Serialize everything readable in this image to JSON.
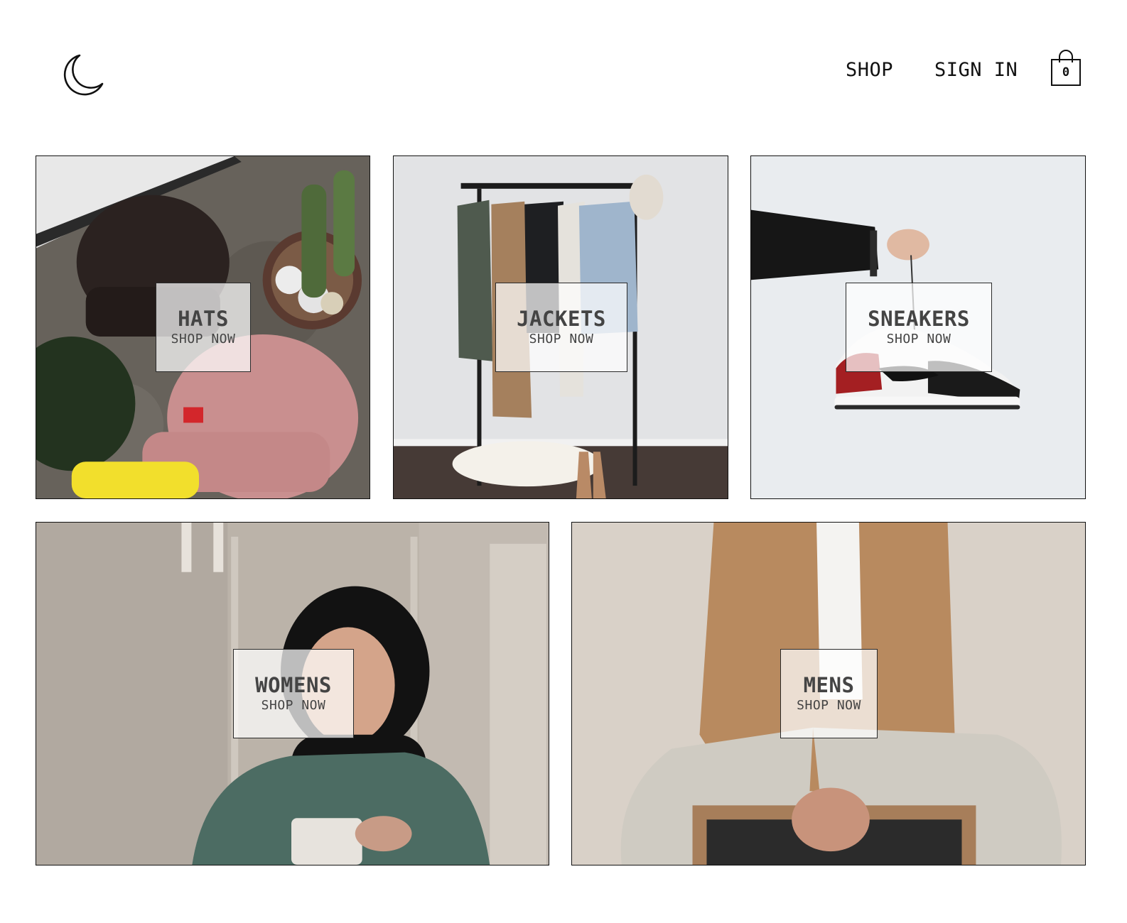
{
  "header": {
    "logo_icon": "crescent-moon-icon",
    "nav": {
      "shop": "SHOP",
      "sign_in": "SIGN IN"
    },
    "cart": {
      "icon": "shopping-bag-icon",
      "count": "0"
    }
  },
  "categories": [
    {
      "title": "HATS",
      "cta": "SHOP NOW"
    },
    {
      "title": "JACKETS",
      "cta": "SHOP NOW"
    },
    {
      "title": "SNEAKERS",
      "cta": "SHOP NOW"
    },
    {
      "title": "WOMENS",
      "cta": "SHOP NOW"
    },
    {
      "title": "MENS",
      "cta": "SHOP NOW"
    }
  ],
  "colors": {
    "text": "#111111",
    "border": "#111111",
    "label_overlay": "#ffffffb8"
  }
}
